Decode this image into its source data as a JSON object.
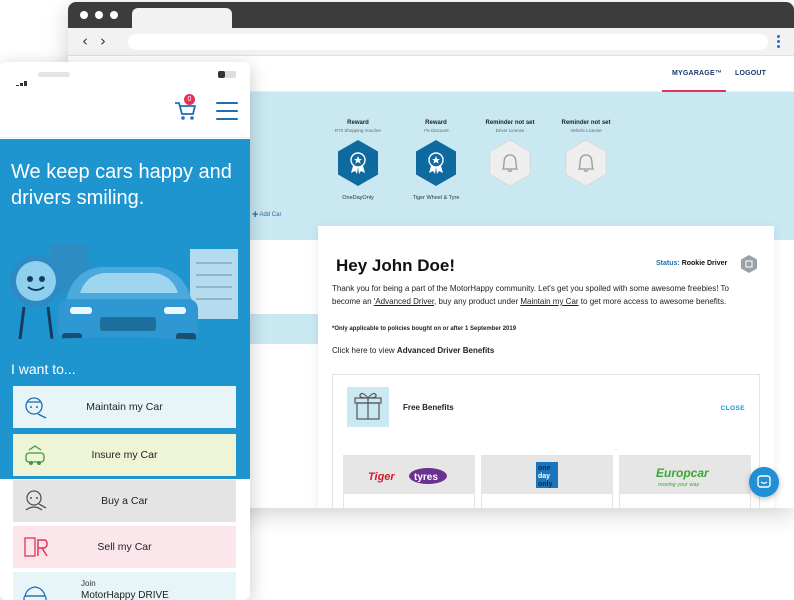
{
  "desktop": {
    "header": {
      "garage_link": "MYGARAGE™",
      "logout_link": "LOGOUT"
    },
    "badges": [
      {
        "title": "Reward",
        "sub": "R70 Shopping Voucher",
        "caption": "OneDayOnly",
        "state": "active",
        "icon": "award-ribbon-icon"
      },
      {
        "title": "Reward",
        "sub": "7% Discount",
        "caption": "Tiger Wheel & Tyre",
        "state": "active",
        "icon": "award-ribbon-icon"
      },
      {
        "title": "Reminder not set",
        "sub": "Driver License",
        "caption": "",
        "state": "inactive",
        "icon": "bell-icon"
      },
      {
        "title": "Reminder not set",
        "sub": "Vehicle License",
        "caption": "",
        "state": "inactive",
        "icon": "bell-icon"
      }
    ],
    "add_car": "Add Car",
    "card": {
      "greeting": "Hey John Doe!",
      "status_label": "Status:",
      "status_value": "Rookie Driver",
      "intro_1": "Thank you for being a part of the MotorHappy community. Let's get you spoiled with some awesome freebies! To become an ",
      "intro_link_1": "'Advanced Driver",
      "intro_2": ", buy any product under ",
      "intro_link_2": "Maintain my Car",
      "intro_3": " to get more access to awesome benefits.",
      "note": "*Only applicable to policies bought on or after 1 September 2019",
      "benefits_prefix": "Click here to view ",
      "benefits_bold": "Advanced Driver Benefits",
      "free_benefits_title": "Free Benefits",
      "close_label": "CLOSE",
      "partners": [
        {
          "name": "Tiger Wheel & Tyre",
          "logo_word_1": "Tiger",
          "logo_word_2": "tyres"
        },
        {
          "name": "OneDayOnly",
          "logo_word_1": "one",
          "logo_word_2": "day",
          "logo_word_3": "only"
        },
        {
          "name": "Europcar",
          "logo_word_1": "Europcar",
          "logo_word_2": "moving your way"
        }
      ]
    }
  },
  "mobile": {
    "cart_count": "0",
    "hero_title": "We keep cars happy and drivers smiling.",
    "want_label": "I want to...",
    "options": [
      {
        "label": "Maintain my Car",
        "bg": "#e7f5f9",
        "icon": "mechanic-icon"
      },
      {
        "label": "Insure my Car",
        "bg": "#eef5d6",
        "icon": "insurance-car-icon"
      },
      {
        "label": "Buy a Car",
        "bg": "#e4e4e4",
        "icon": "car-dealer-icon"
      },
      {
        "label": "Sell my Car",
        "bg": "#fbe6ec",
        "icon": "sell-car-icon"
      },
      {
        "sub": "Join",
        "label": "MotorHappy DRIVE",
        "bg": "#e7f5f9",
        "icon": "drive-club-icon"
      }
    ]
  },
  "colors": {
    "brand_blue": "#1f95cf",
    "navy": "#173a6b",
    "accent_pink": "#e5315a",
    "badge_active": "#0f6aa0",
    "band": "#c9e8f2"
  }
}
